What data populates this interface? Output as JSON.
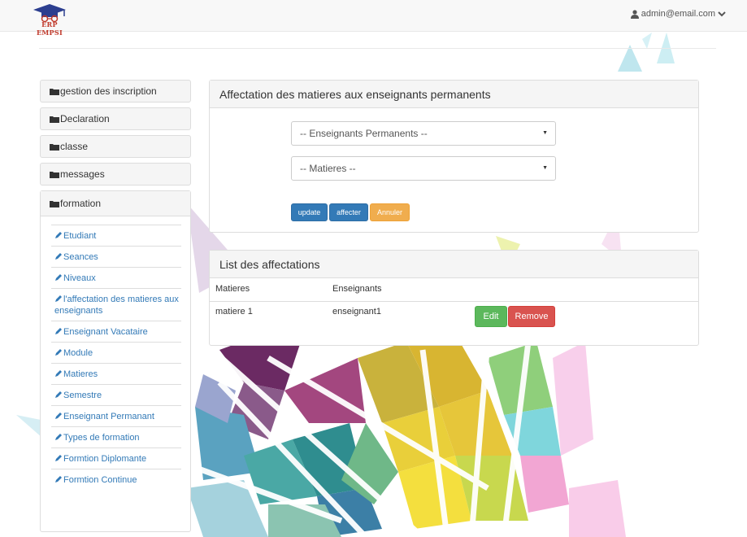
{
  "header": {
    "logo_text": "ERP EMPSI",
    "user_email": "admin@email.com",
    "user_icon": "user-icon",
    "dropdown_icon": "chevron-down-icon"
  },
  "sidebar": {
    "sections": [
      {
        "label": "gestion des inscription"
      },
      {
        "label": "Declaration"
      },
      {
        "label": "classe"
      },
      {
        "label": "messages"
      }
    ],
    "open_section": {
      "label": "formation",
      "items": [
        {
          "label": "Etudiant"
        },
        {
          "label": "Seances"
        },
        {
          "label": "Niveaux"
        },
        {
          "label": "l'affectation des matieres aux enseignants"
        },
        {
          "label": "Enseignant Vacataire"
        },
        {
          "label": "Module"
        },
        {
          "label": "Matieres"
        },
        {
          "label": "Semestre"
        },
        {
          "label": "Enseignant Permanant"
        },
        {
          "label": "Types de formation"
        },
        {
          "label": "Formtion Diplomante"
        },
        {
          "label": "Formtion Continue"
        }
      ]
    }
  },
  "affectation_panel": {
    "title": "Affectation des matieres aux enseignants permanents",
    "enseignant_select": "-- Enseignants Permanents --",
    "matiere_select": "-- Matieres --",
    "update_label": "update",
    "affecter_label": "affecter",
    "annuler_label": "Annuler"
  },
  "list_panel": {
    "title": "List des affectations",
    "columns": [
      "Matieres",
      "Enseignants"
    ],
    "rows": [
      {
        "matiere": "matiere 1",
        "enseignant": "enseignant1",
        "edit_label": "Edit",
        "remove_label": "Remove"
      }
    ]
  },
  "colors": {
    "primary": "#337ab7",
    "success": "#5cb85c",
    "danger": "#d9534f",
    "warning": "#f0ad4e",
    "link": "#337ab7"
  }
}
